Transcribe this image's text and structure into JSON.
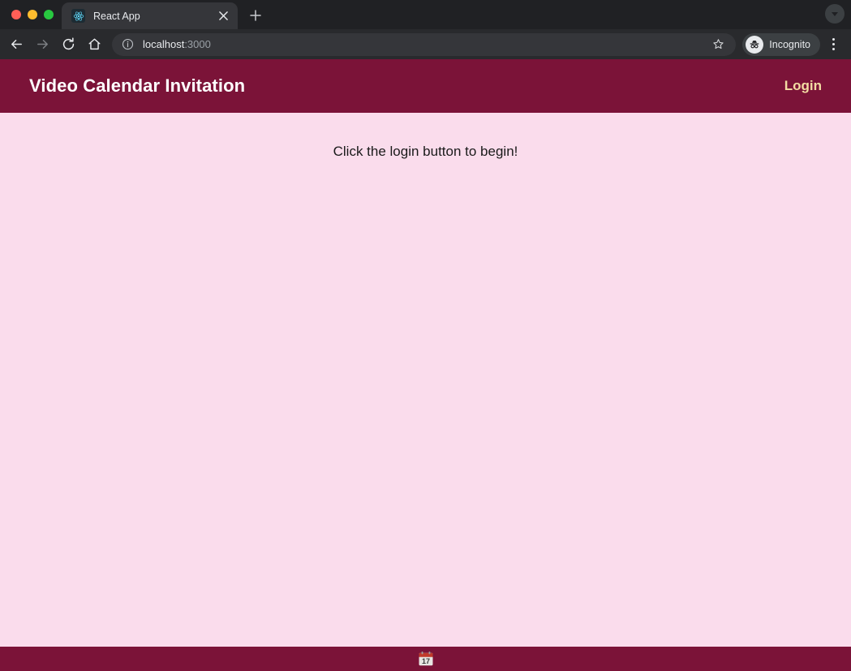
{
  "browser": {
    "window_controls": [
      {
        "name": "close",
        "color": "#ff5f57"
      },
      {
        "name": "minimize",
        "color": "#febc2e"
      },
      {
        "name": "maximize",
        "color": "#28c840"
      }
    ],
    "tab": {
      "title": "React App",
      "favicon": "react-logo-icon",
      "close_label": "×"
    },
    "new_tab_label": "+",
    "tab_search_icon": "chevron-down-icon",
    "nav": {
      "back_icon": "arrow-left-icon",
      "forward_icon": "arrow-right-icon",
      "reload_icon": "reload-icon",
      "home_icon": "home-icon"
    },
    "omnibox": {
      "info_icon": "info-circle-icon",
      "host": "localhost",
      "port": ":3000",
      "bookmark_icon": "star-icon"
    },
    "profile": {
      "label": "Incognito",
      "icon": "incognito-icon"
    },
    "menu_icon": "three-dot-menu-icon"
  },
  "page": {
    "header": {
      "title": "Video Calendar Invitation",
      "login_label": "Login"
    },
    "main": {
      "message": "Click the login button to begin!"
    },
    "footer": {
      "icon": "calendar-icon",
      "calendar_day": "17"
    }
  },
  "colors": {
    "brand_maroon": "#7b1338",
    "page_background": "#fadcec",
    "login_gold": "#f3dca3",
    "title_white": "#ffffff",
    "chrome_tabstrip": "#202124",
    "chrome_toolbar": "#292a2d"
  }
}
